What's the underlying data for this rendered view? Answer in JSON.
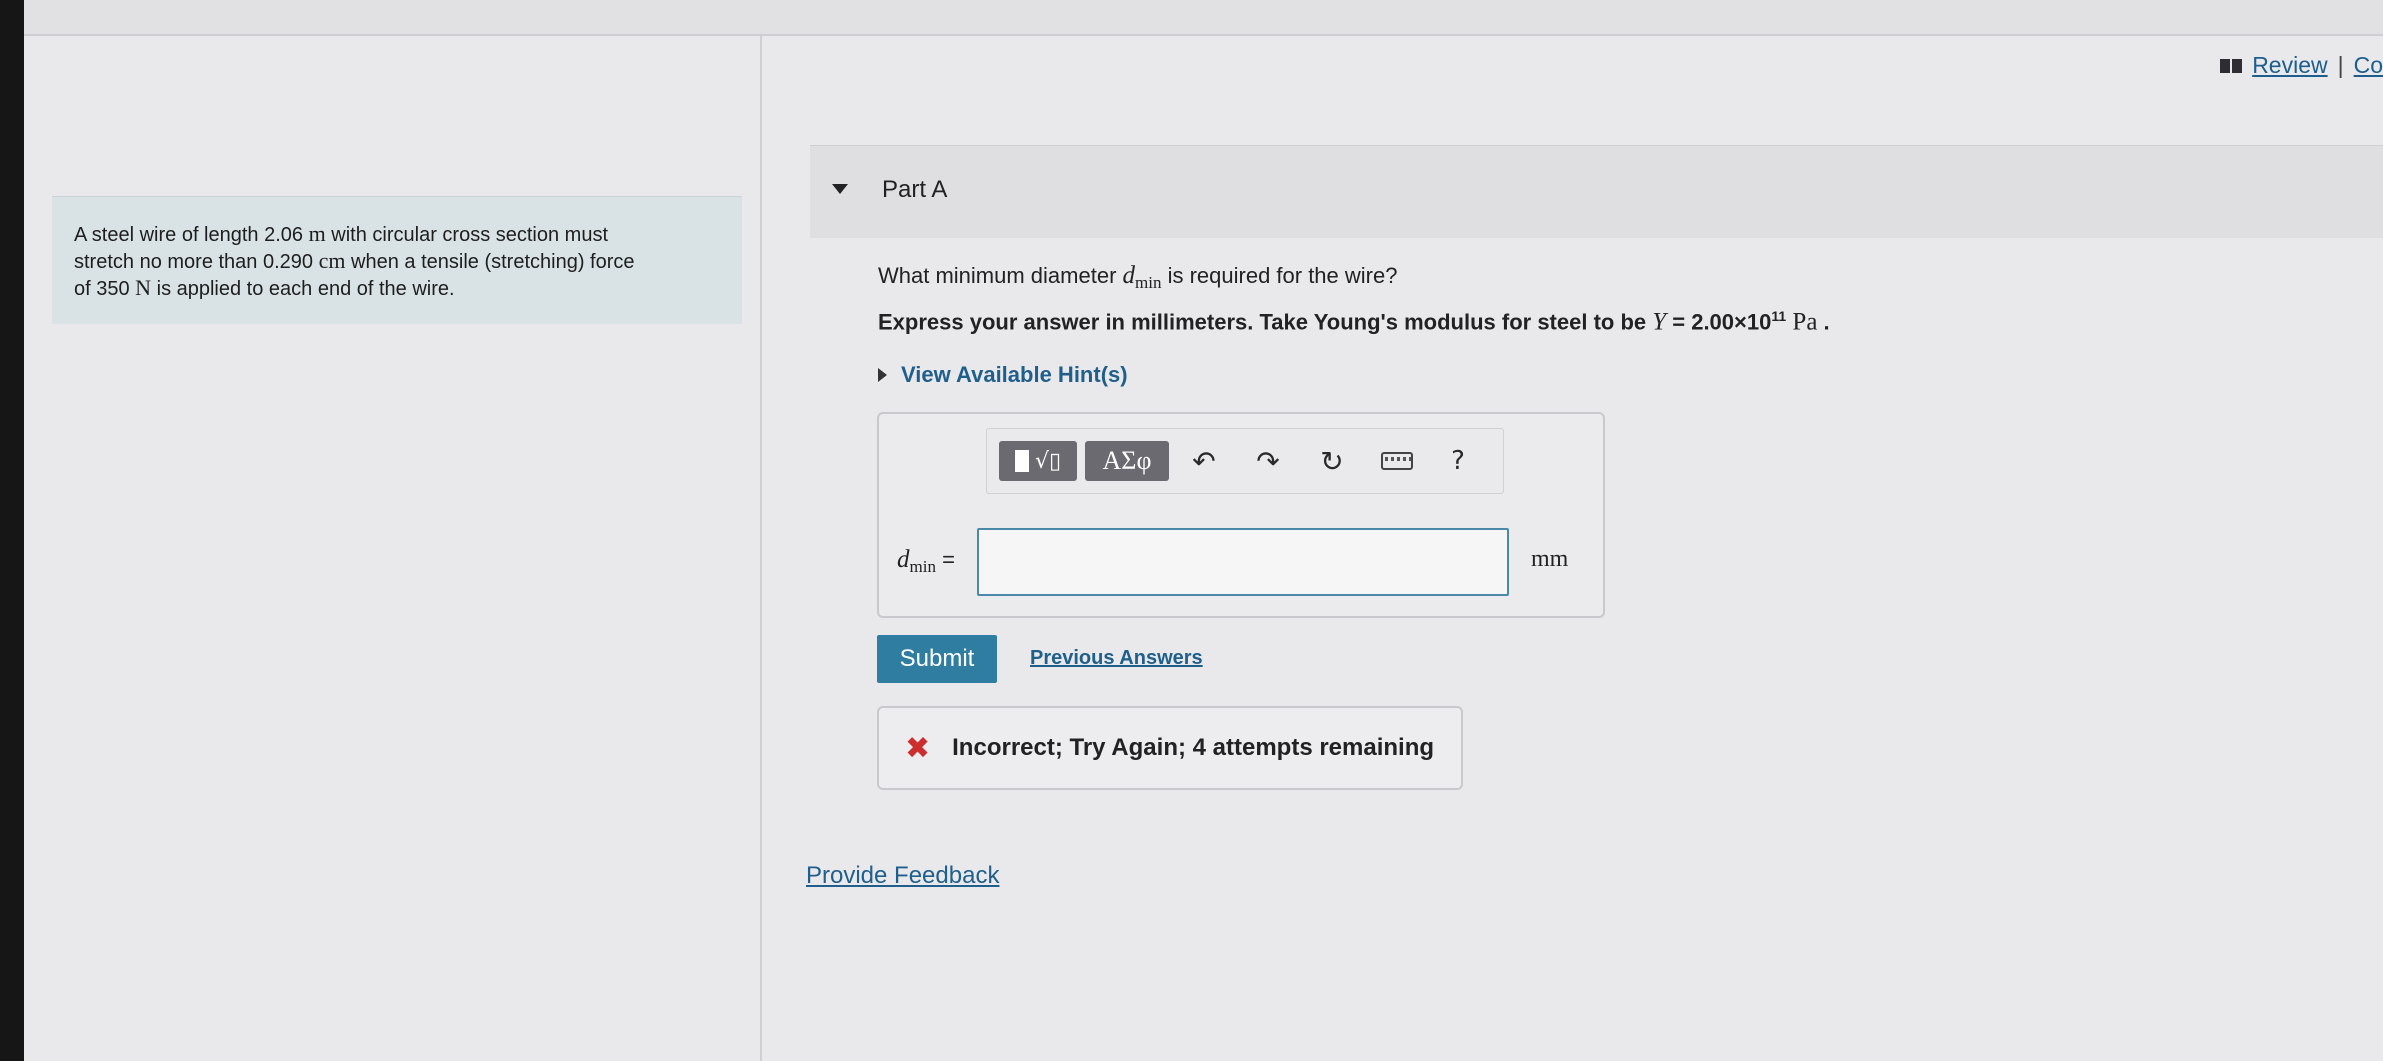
{
  "top_links": {
    "review": "Review",
    "separator": "|",
    "constants": "Co"
  },
  "problem": {
    "line1_a": "A steel wire of length 2.06 ",
    "line1_unit": "m",
    "line1_b": " with circular cross section must",
    "line2_a": "stretch no more than 0.290 ",
    "line2_unit": "cm",
    "line2_b": " when a tensile (stretching) force",
    "line3_a": "of 350 ",
    "line3_unit": "N",
    "line3_b": " is applied to each end of the wire."
  },
  "part": {
    "title": "Part A"
  },
  "question": {
    "prefix": "What minimum diameter ",
    "var": "d",
    "var_sub": "min",
    "suffix": " is required for the wire?"
  },
  "instruction": {
    "text": "Express your answer in millimeters. Take Young's modulus for steel to be ",
    "Y": "Y",
    "eq": " = 2.00×10",
    "exp": "11",
    "unit": " Pa",
    "end": " ."
  },
  "hints": {
    "label": "View Available Hint(s)"
  },
  "toolbar": {
    "greek_label": "ΑΣφ",
    "undo_glyph": "↶",
    "redo_glyph": "↷",
    "reset_glyph": "↻",
    "help_glyph": "?"
  },
  "answer": {
    "var": "d",
    "var_sub": "min",
    "equals": " =",
    "value": "",
    "unit": "mm"
  },
  "actions": {
    "submit": "Submit",
    "previous_answers": "Previous Answers"
  },
  "feedback": {
    "icon": "✖",
    "text": "Incorrect; Try Again; 4 attempts remaining"
  },
  "footer": {
    "provide_feedback": "Provide Feedback"
  },
  "colors": {
    "accent": "#2f7da1",
    "link": "#1f5f8b",
    "error": "#cc2e2e",
    "problem_bg": "#d9e3e5"
  }
}
